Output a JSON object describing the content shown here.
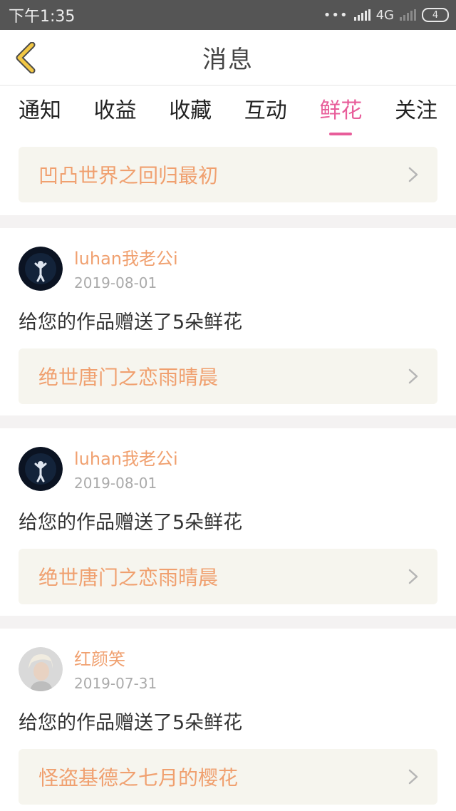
{
  "status_bar": {
    "time": "下午1:35",
    "network": "4G",
    "battery": "4"
  },
  "header": {
    "title": "消息"
  },
  "tabs": [
    {
      "label": "通知",
      "active": false
    },
    {
      "label": "收益",
      "active": false
    },
    {
      "label": "收藏",
      "active": false
    },
    {
      "label": "互动",
      "active": false
    },
    {
      "label": "鲜花",
      "active": true
    },
    {
      "label": "关注",
      "active": false
    }
  ],
  "top_work": {
    "title": "凹凸世界之回归最初"
  },
  "entries": [
    {
      "username": "luhan我老公i",
      "date": "2019-08-01",
      "message": "给您的作品赠送了5朵鲜花",
      "work_title": "绝世唐门之恋雨晴晨",
      "avatar": "dark-stage-avatar"
    },
    {
      "username": "luhan我老公i",
      "date": "2019-08-01",
      "message": "给您的作品赠送了5朵鲜花",
      "work_title": "绝世唐门之恋雨晴晨",
      "avatar": "dark-stage-avatar"
    },
    {
      "username": "红颜笑",
      "date": "2019-07-31",
      "message": "给您的作品赠送了5朵鲜花",
      "work_title": "怪盗基德之七月的樱花",
      "avatar": "portrait-avatar"
    }
  ],
  "colors": {
    "accent_pink": "#e85d9a",
    "accent_orange": "#f0a06f",
    "back_arrow": "#f2c744",
    "card_background": "#f6f5ee",
    "status_bar": "#555555"
  }
}
